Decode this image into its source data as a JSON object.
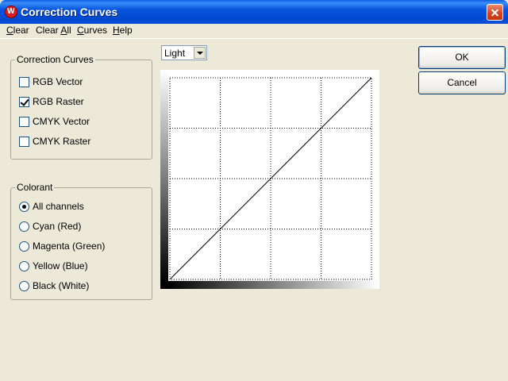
{
  "window": {
    "title": "Correction Curves"
  },
  "menu": {
    "items": [
      {
        "label": "Clear",
        "mnemonic_index": 0
      },
      {
        "label": "Clear All",
        "mnemonic_index": 6
      },
      {
        "label": "Curves",
        "mnemonic_index": 0
      },
      {
        "label": "Help",
        "mnemonic_index": 0
      }
    ]
  },
  "correction_curves": {
    "title": "Correction Curves",
    "options": [
      {
        "label": "RGB Vector",
        "checked": false
      },
      {
        "label": "RGB Raster",
        "checked": true
      },
      {
        "label": "CMYK Vector",
        "checked": false
      },
      {
        "label": "CMYK Raster",
        "checked": false
      }
    ]
  },
  "colorant": {
    "title": "Colorant",
    "options": [
      {
        "label": "All channels",
        "selected": true
      },
      {
        "label": "Cyan (Red)",
        "selected": false
      },
      {
        "label": "Magenta (Green)",
        "selected": false
      },
      {
        "label": "Yellow (Blue)",
        "selected": false
      },
      {
        "label": "Black (White)",
        "selected": false
      }
    ]
  },
  "mode_select": {
    "value": "Light"
  },
  "curve": {
    "grid_divisions": 4,
    "points": [
      [
        0,
        0
      ],
      [
        1,
        1
      ]
    ]
  },
  "buttons": {
    "ok": "OK",
    "cancel": "Cancel"
  },
  "colors": {
    "titlebar": "#0855dd",
    "face": "#ece9d8",
    "groupbox_border": "#aca899",
    "button_border": "#003c74"
  }
}
